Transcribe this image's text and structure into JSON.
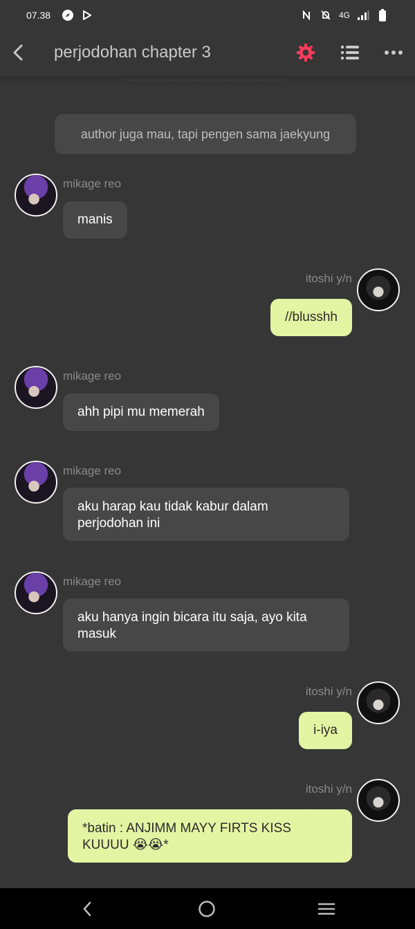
{
  "status_bar": {
    "time": "07.38",
    "network": "4G"
  },
  "header": {
    "title": "perjodohan chapter 3",
    "back_icon": "chevron-left-icon",
    "settings_icon": "gear-icon",
    "list_icon": "list-icon",
    "more_icon": "more-horizontal-icon",
    "accent_color": "#ff3b5c"
  },
  "messages": [
    {
      "type": "narration",
      "text": "author juga mau, tapi pengen sama jaekyung"
    },
    {
      "type": "incoming",
      "sender": "mikage reo",
      "text": "manis"
    },
    {
      "type": "outgoing",
      "sender": "itoshi y/n",
      "text": "//blusshh"
    },
    {
      "type": "incoming",
      "sender": "mikage reo",
      "text": "ahh pipi mu memerah"
    },
    {
      "type": "incoming",
      "sender": "mikage reo",
      "text": "aku harap kau tidak kabur dalam perjodohan ini"
    },
    {
      "type": "incoming",
      "sender": "mikage reo",
      "text": "aku hanya ingin bicara itu saja, ayo kita masuk"
    },
    {
      "type": "outgoing",
      "sender": "itoshi y/n",
      "text": "i-iya"
    },
    {
      "type": "outgoing",
      "sender": "itoshi y/n",
      "text": "*batin : ANJIMM MAYY FIRTS KISS KUUUU 😭😭*"
    }
  ],
  "colors": {
    "background": "#363636",
    "incoming_bubble": "#474747",
    "outgoing_bubble": "#e3f4a3"
  },
  "nav_bar": {
    "back_icon": "nav-back-icon",
    "home_icon": "nav-home-icon",
    "recent_icon": "nav-recent-apps-icon"
  }
}
